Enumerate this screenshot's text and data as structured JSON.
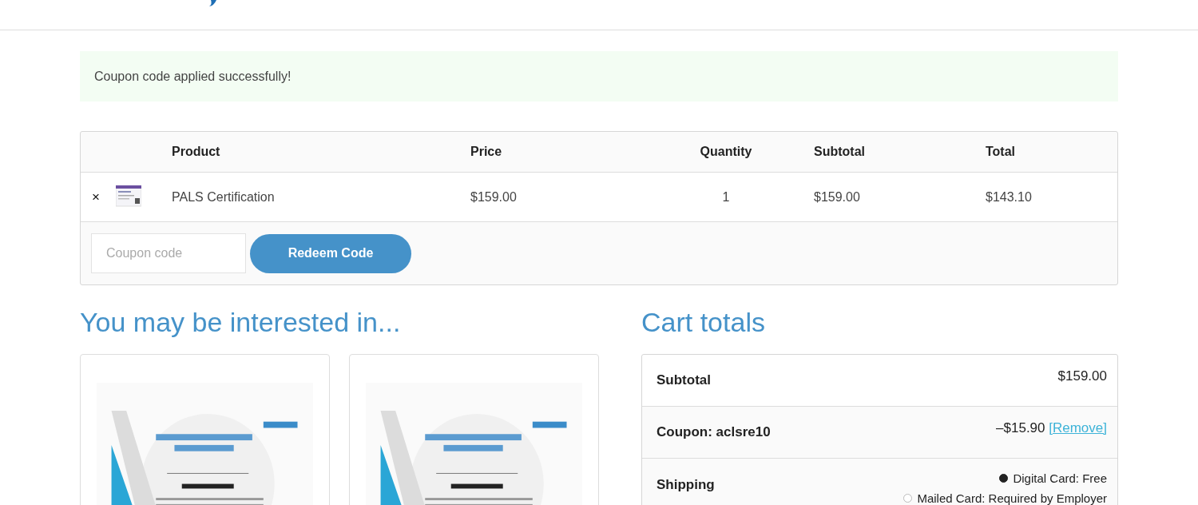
{
  "notice": {
    "message": "Coupon code applied successfully!"
  },
  "cart": {
    "columns": [
      "Product",
      "Price",
      "Quantity",
      "Subtotal",
      "Total"
    ],
    "rows": [
      {
        "remove": "×",
        "product": "PALS Certification",
        "price": "$159.00",
        "quantity": "1",
        "subtotal": "$159.00",
        "total": "$143.10"
      }
    ],
    "coupon": {
      "placeholder": "Coupon code",
      "button": "Redeem Code"
    }
  },
  "related": {
    "title": "You may be interested in..."
  },
  "totals": {
    "title": "Cart totals",
    "subtotal": {
      "label": "Subtotal",
      "value": "$159.00"
    },
    "coupon": {
      "label": "Coupon: aclsre10",
      "value": "–$15.90",
      "remove": "[Remove]"
    },
    "shipping": {
      "label": "Shipping",
      "options": [
        {
          "label": "Digital Card: Free",
          "selected": true
        },
        {
          "label": "Mailed Card: Required by Employer",
          "selected": false
        }
      ]
    }
  }
}
